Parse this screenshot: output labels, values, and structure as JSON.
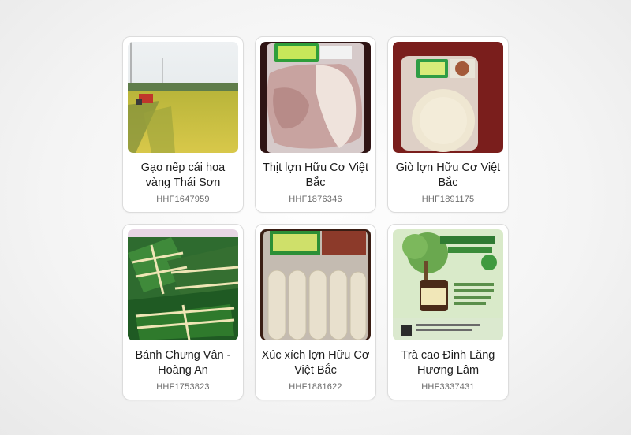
{
  "products": [
    {
      "name": "Gạo nếp cái hoa vàng Thái Sơn",
      "code": "HHF1647959",
      "image": "rice-field-image"
    },
    {
      "name": "Thịt lợn Hữu Cơ Việt Bắc",
      "code": "HHF1876346",
      "image": "packaged-pork-image"
    },
    {
      "name": "Giò lợn Hữu Cơ Việt Bắc",
      "code": "HHF1891175",
      "image": "packaged-pork-roll-image"
    },
    {
      "name": "Bánh Chưng Vân - Hoàng An",
      "code": "HHF1753823",
      "image": "banh-chung-image"
    },
    {
      "name": "Xúc xích lợn Hữu Cơ Việt Bắc",
      "code": "HHF1881622",
      "image": "sausage-pack-image"
    },
    {
      "name": "Trà cao Đinh Lăng Hương Lâm",
      "code": "HHF3337431",
      "image": "tea-poster-image"
    }
  ],
  "colors": {
    "card_border": "#dcdcdc",
    "title_text": "#1c1c1c",
    "code_text": "#6b6b6b"
  }
}
